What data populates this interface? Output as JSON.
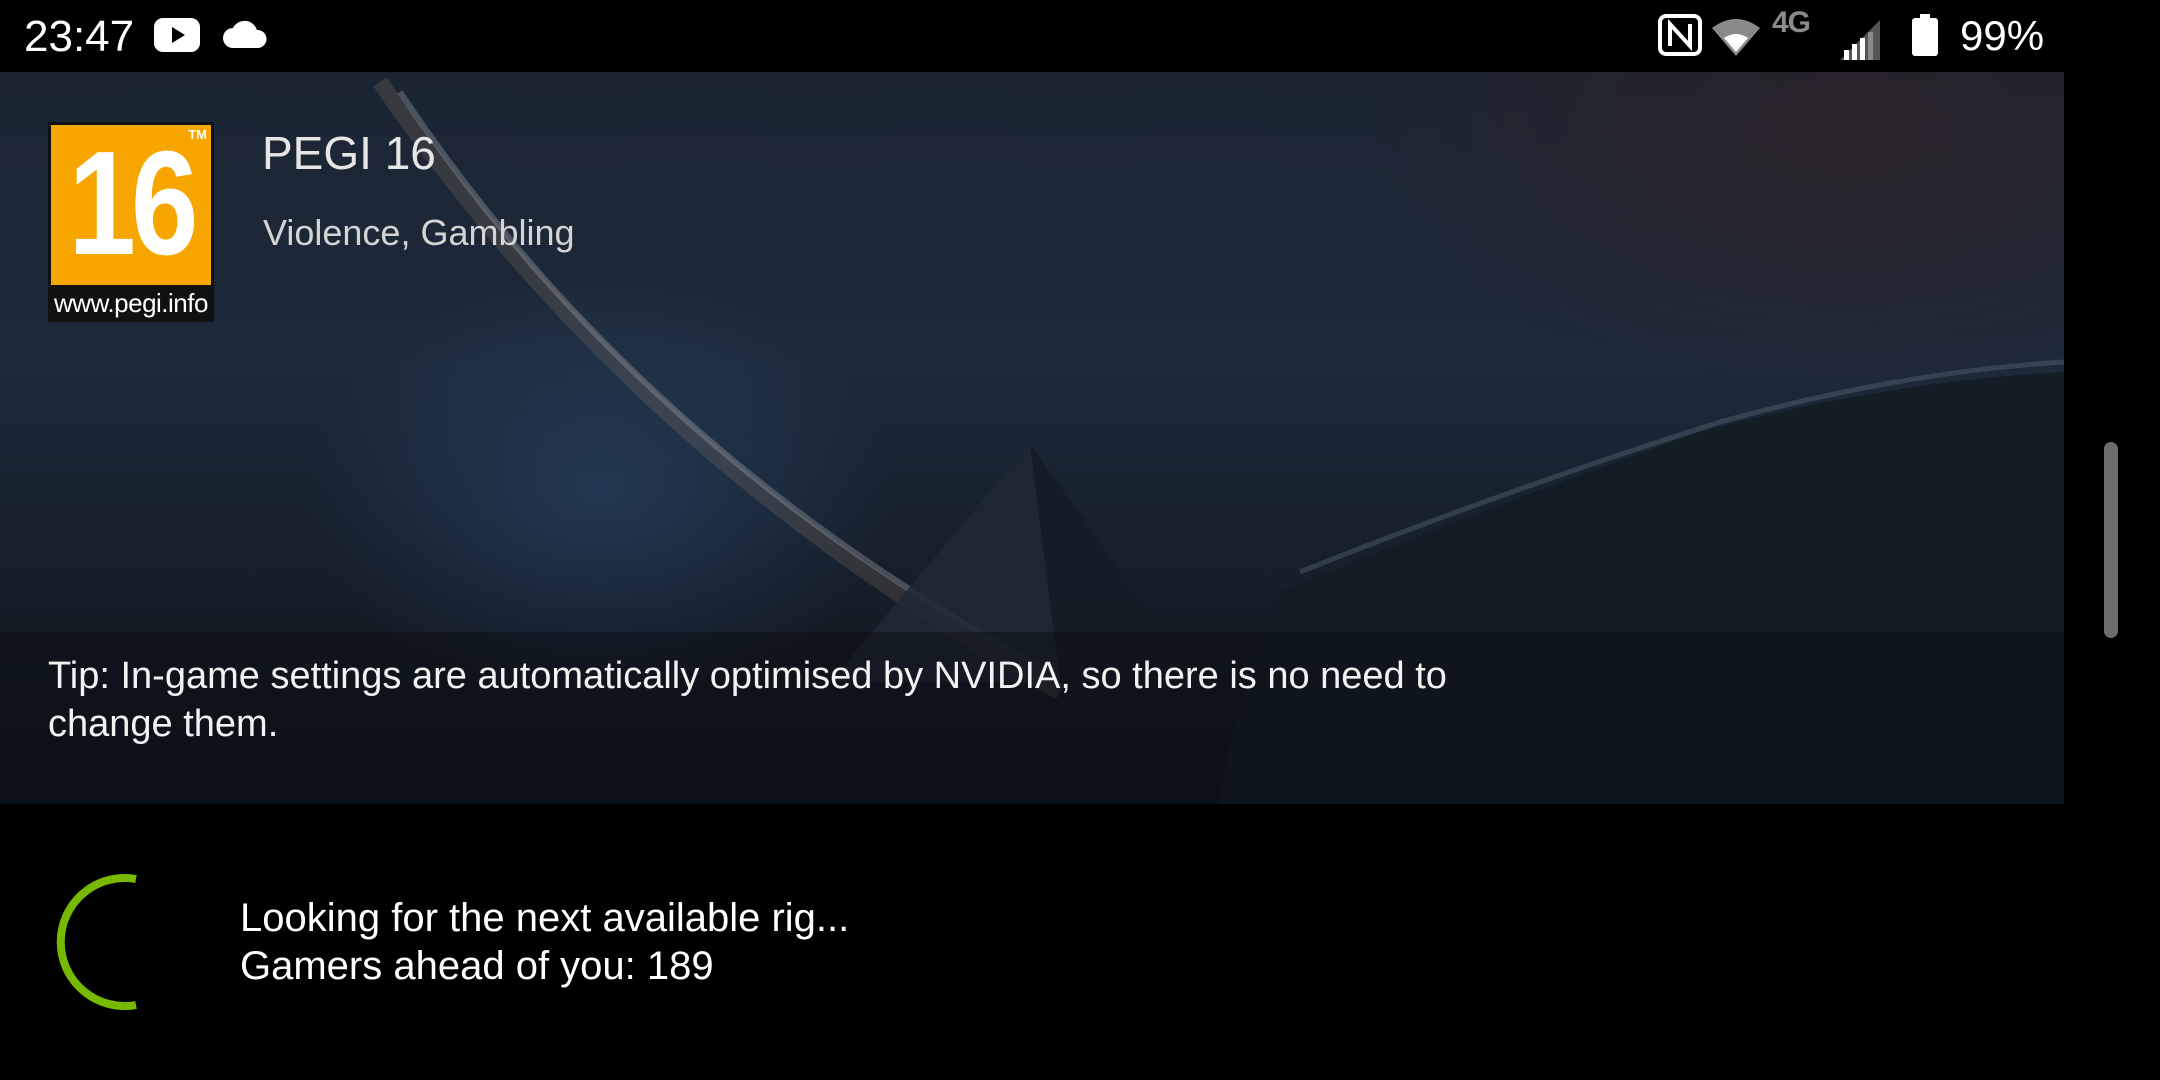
{
  "status_bar": {
    "time": "23:47",
    "left_icons": [
      "youtube-icon",
      "cloud-icon"
    ],
    "right_icons": [
      "nfc-icon",
      "wifi-icon",
      "4g-lte-icon",
      "signal-icon",
      "battery-icon"
    ],
    "network_label": "4G",
    "battery_percent": "99%"
  },
  "rating": {
    "badge_number": "16",
    "badge_trademark": "TM",
    "badge_url": "www.pegi.info",
    "title": "PEGI 16",
    "descriptors": "Violence, Gambling",
    "badge_color": "#f7a600"
  },
  "tip": {
    "text": "Tip: In-game settings are automatically optimised by NVIDIA, so there is no need to change them."
  },
  "queue": {
    "status_line": "Looking for the next available rig...",
    "position_line": "Gamers ahead of you: 189",
    "spinner_color": "#76b900"
  }
}
